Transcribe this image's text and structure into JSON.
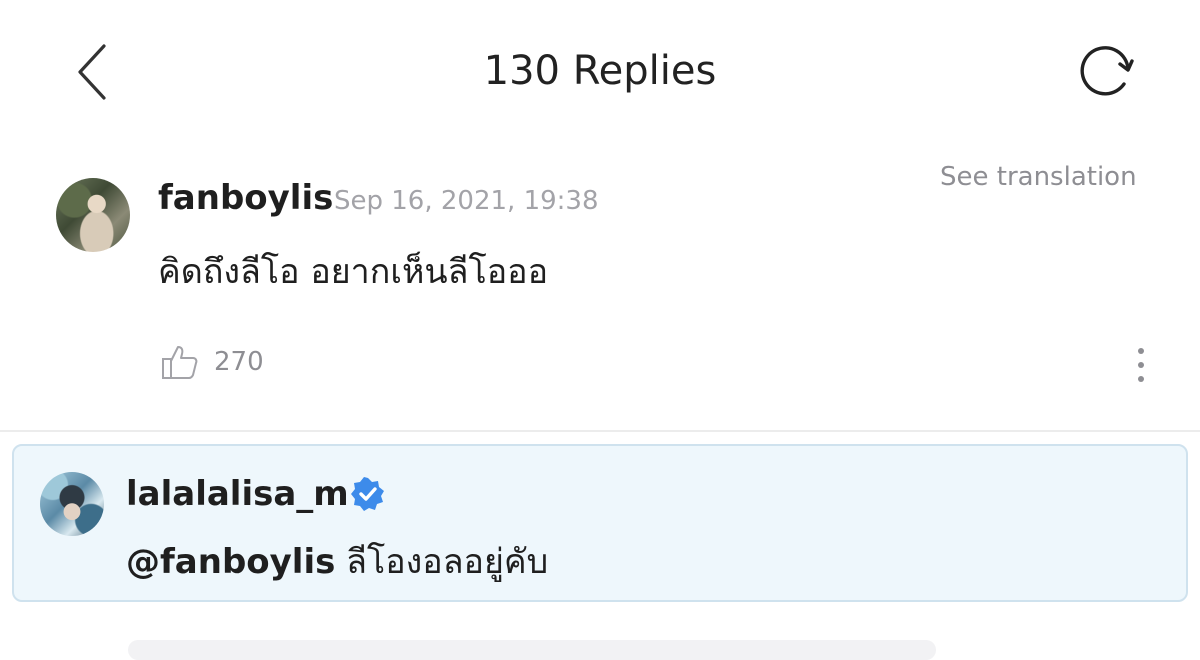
{
  "header": {
    "title": "130 Replies",
    "back_icon": "chevron-left-icon",
    "refresh_icon": "refresh-icon"
  },
  "comment": {
    "username": "fanboylis",
    "timestamp": "Sep 16, 2021, 19:38",
    "see_translation": "See translation",
    "text": "คิดถึงลีโอ อยากเห็นลีโอออ",
    "likes": "270",
    "like_icon": "thumbs-up-icon",
    "more_icon": "more-vertical-icon"
  },
  "reply": {
    "username": "lalalalisa_m",
    "verified": true,
    "verified_color": "#3d8bea",
    "mention": "@fanboylis",
    "text": " ลีโองอลอยู่คับ"
  },
  "colors": {
    "reply_background": "#eef7fc",
    "reply_border": "#cfe2ee",
    "secondary_text": "#8e8e93"
  }
}
